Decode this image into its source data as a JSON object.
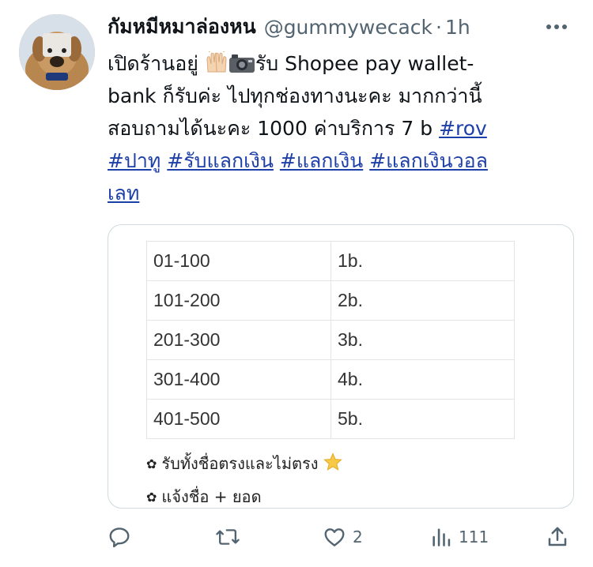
{
  "tweet": {
    "display_name": "กัมหมีหมาล่องหน",
    "handle": "@gummywecack",
    "separator": "·",
    "time": "1h",
    "lines": [
      {
        "pre": "เปิดร้านอยู่ ",
        "post": "รับ Shopee pay  wallet-"
      },
      {
        "text": "bank ก็รับค่ะ ไปทุกช่องทางนะคะ มากกว่านี้"
      },
      {
        "text": "สอบถามได้นะคะ 1000 ค่าบริการ  7 b "
      }
    ],
    "hashtags": [
      "#rov",
      "#ปาทู",
      "#รับแลกเงิน",
      "#แลกเงิน",
      "#แลกเงินวอล",
      "เลท"
    ]
  },
  "media": {
    "rows": [
      {
        "range": "01-100",
        "price": "1b."
      },
      {
        "range": "101-200",
        "price": "2b."
      },
      {
        "range": "201-300",
        "price": "3b."
      },
      {
        "range": "301-400",
        "price": "4b."
      },
      {
        "range": "401-500",
        "price": "5b."
      }
    ],
    "note_1": "รับทั้งชื่อตรงและไม่ตรง",
    "note_2": "แจ้งชื่อ + ยอด"
  },
  "actions": {
    "replies": "",
    "retweets": "",
    "likes": "2",
    "views": "111"
  },
  "icons": {
    "more": "more-dots-icon",
    "reply": "reply-icon",
    "retweet": "retweet-icon",
    "like": "heart-icon",
    "views": "views-icon",
    "share": "share-icon"
  },
  "colors": {
    "text": "#0f1419",
    "secondary": "#536471",
    "link": "#1d3fa8",
    "border": "#cfd9de"
  }
}
